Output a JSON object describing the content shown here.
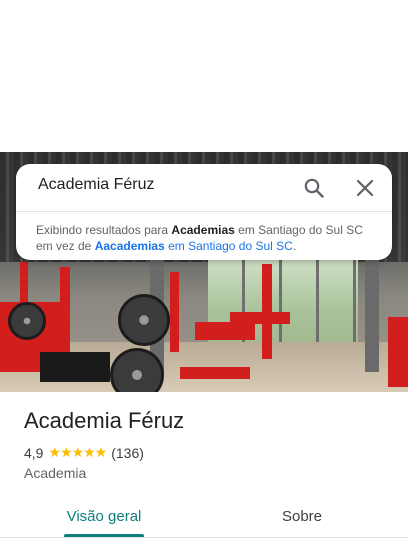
{
  "search": {
    "query": "Academia Féruz",
    "notice_prefix": "Exibindo resultados para ",
    "notice_term": "Academias",
    "notice_middle": " em Santiago do Sul SC em vez de ",
    "notice_original_term": "Aacademias",
    "notice_original_location": " em Santiago do Sul SC",
    "notice_end": "."
  },
  "icons": {
    "search": "search-icon",
    "close": "close-icon"
  },
  "place": {
    "name": "Academia Féruz",
    "rating": "4,9",
    "stars": "★★★★★",
    "review_count": "(136)",
    "category": "Academia"
  },
  "tabs": [
    {
      "label": "Visão geral",
      "active": true
    },
    {
      "label": "Sobre",
      "active": false
    }
  ],
  "colors": {
    "accent": "#0f7e7e",
    "star": "#fbbc04",
    "link": "#1a73e8"
  }
}
